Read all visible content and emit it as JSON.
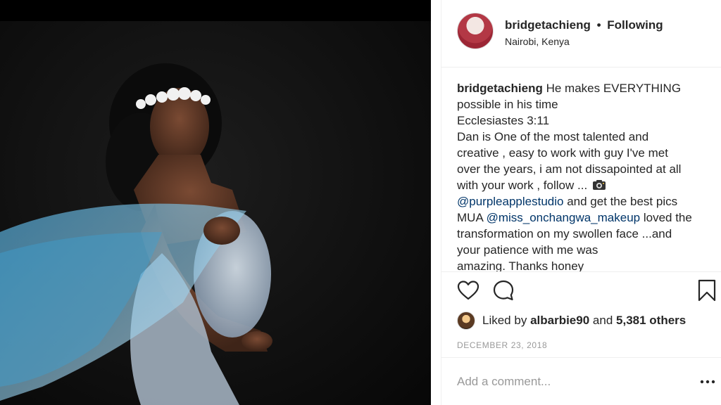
{
  "post": {
    "username": "bridgetachieng",
    "separator": "•",
    "following_label": "Following",
    "location": "Nairobi, Kenya"
  },
  "caption": {
    "author": "bridgetachieng",
    "line1": "He makes EVERYTHING",
    "line2": "possible in his time",
    "line3": "Ecclesiastes 3:11",
    "line4": "Dan is One of the most talented and",
    "line5": "creative , easy to work with guy I've met",
    "line6": "over the years, i am not dissapointed at all",
    "line7": "with your work , follow ...",
    "camera_icon": "camera-emoji",
    "mention1": "@purpleapplestudio",
    "line8_rest": " and get the best pics",
    "line9_prefix": "MUA ",
    "mention2": "@miss_onchangwa_makeup",
    "line9_rest": " loved the",
    "line10": "transformation on my swollen face ...and",
    "line11": "your patience with me was",
    "line12": "amazing. Thanks honey"
  },
  "actions": {
    "like_icon": "heart-outline",
    "comment_icon": "speech-bubble",
    "save_icon": "bookmark-outline"
  },
  "likes": {
    "prefix": "Liked by",
    "user": "albarbie90",
    "connector": "and",
    "others": "5,381 others"
  },
  "date": "DECEMBER 23, 2018",
  "comment": {
    "placeholder": "Add a comment...",
    "more_label": "•••"
  },
  "colors": {
    "text": "#262626",
    "mention": "#003569",
    "muted": "#999999",
    "divider": "#efefef",
    "veil": "#5ab0d8"
  }
}
